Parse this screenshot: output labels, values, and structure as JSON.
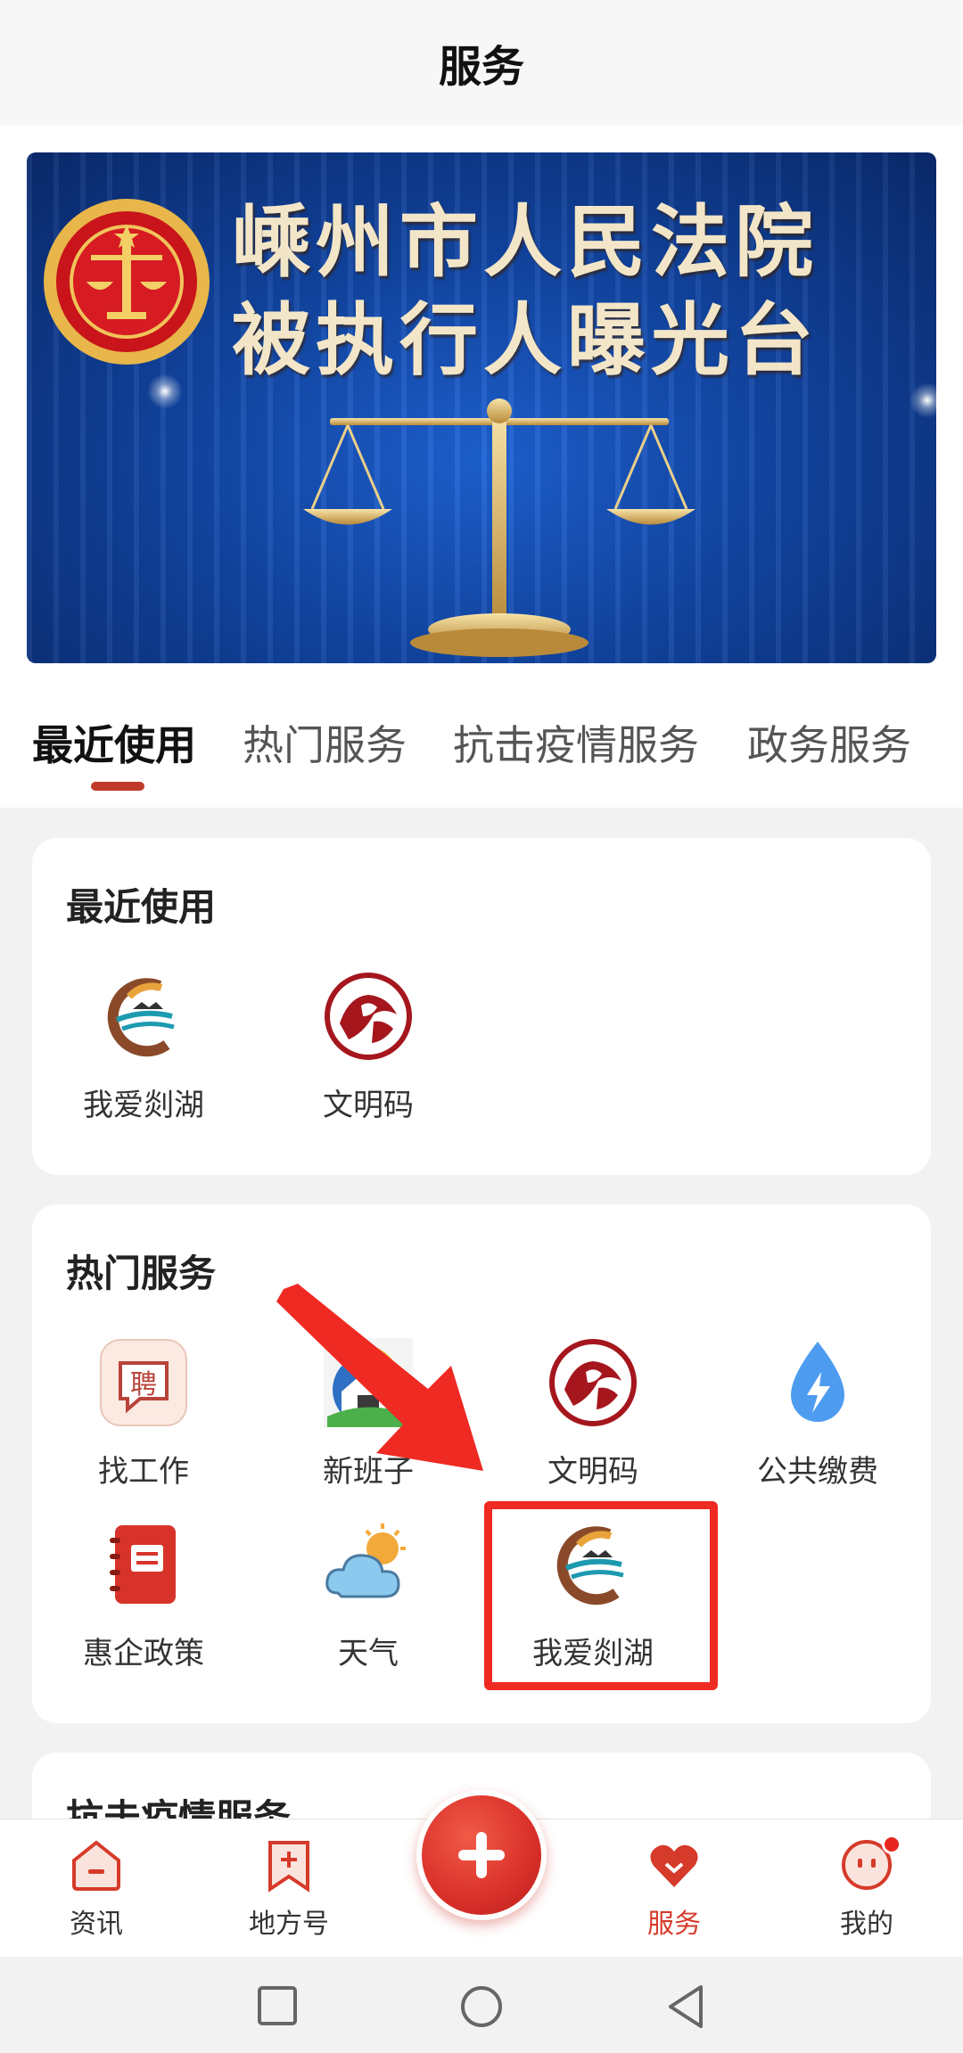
{
  "header": {
    "title": "服务"
  },
  "banner": {
    "line1": "嵊州市人民法院",
    "line2": "被执行人曝光台"
  },
  "tabs": [
    {
      "label": "最近使用",
      "active": true
    },
    {
      "label": "热门服务",
      "active": false
    },
    {
      "label": "抗击疫情服务",
      "active": false
    },
    {
      "label": "政务服务",
      "active": false
    }
  ],
  "recent": {
    "title": "最近使用",
    "items": [
      {
        "label": "我爱剡湖",
        "icon": "wo-ai-shan-hu-logo-icon"
      },
      {
        "label": "文明码",
        "icon": "wen-ming-ma-logo-icon"
      }
    ]
  },
  "hot": {
    "title": "热门服务",
    "items": [
      {
        "label": "找工作",
        "icon": "recruit-icon"
      },
      {
        "label": "新班子",
        "icon": "house-icon"
      },
      {
        "label": "文明码",
        "icon": "wen-ming-ma-logo-icon"
      },
      {
        "label": "公共缴费",
        "icon": "water-drop-bolt-icon"
      },
      {
        "label": "惠企政策",
        "icon": "notebook-icon"
      },
      {
        "label": "天气",
        "icon": "weather-cloud-sun-icon"
      },
      {
        "label": "我爱剡湖",
        "icon": "wo-ai-shan-hu-logo-icon"
      }
    ]
  },
  "partial_card": {
    "title": "抗击疫情服务"
  },
  "bottom_nav": {
    "items": [
      {
        "label": "资讯",
        "icon": "news-icon"
      },
      {
        "label": "地方号",
        "icon": "bookmark-plus-icon"
      },
      {
        "label": "服务",
        "icon": "heart-icon",
        "active": true
      },
      {
        "label": "我的",
        "icon": "profile-face-icon"
      }
    ],
    "fab_icon": "plus-icon"
  },
  "colors": {
    "accent": "#d63a2a",
    "highlight": "#ef2a23",
    "banner_blue": "#1247a6"
  }
}
